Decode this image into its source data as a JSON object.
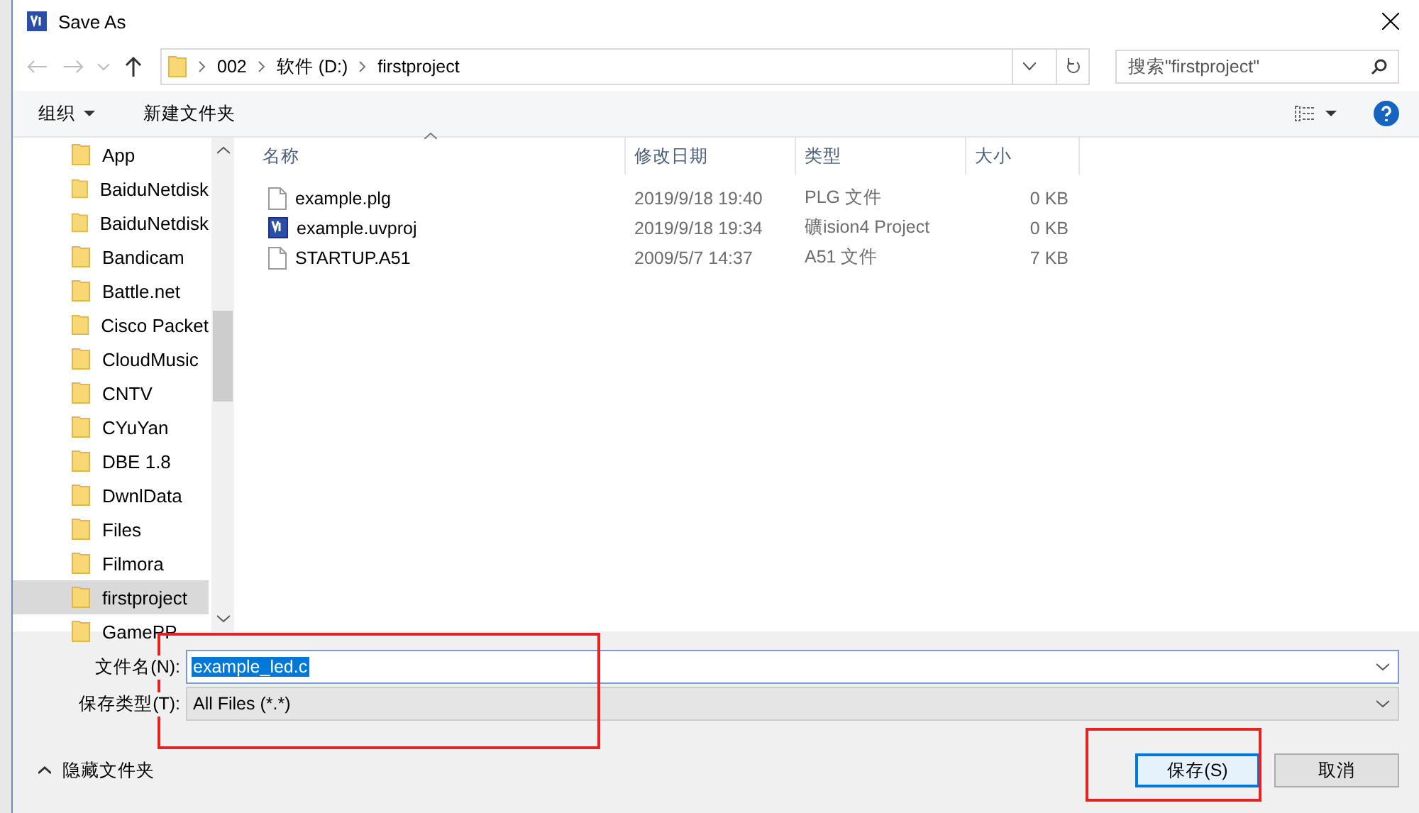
{
  "window": {
    "title": "Save As"
  },
  "address": {
    "crumbs": [
      "002",
      "软件 (D:)",
      "firstproject"
    ]
  },
  "search": {
    "placeholder": "搜索\"firstproject\""
  },
  "toolbar": {
    "organize": "组织",
    "new_folder": "新建文件夹"
  },
  "sidebar": {
    "items": [
      {
        "label": "App",
        "selected": false
      },
      {
        "label": "BaiduNetdisk",
        "selected": false
      },
      {
        "label": "BaiduNetdisk",
        "selected": false
      },
      {
        "label": "Bandicam",
        "selected": false
      },
      {
        "label": "Battle.net",
        "selected": false
      },
      {
        "label": "Cisco Packet",
        "selected": false
      },
      {
        "label": "CloudMusic",
        "selected": false
      },
      {
        "label": "CNTV",
        "selected": false
      },
      {
        "label": "CYuYan",
        "selected": false
      },
      {
        "label": "DBE 1.8",
        "selected": false
      },
      {
        "label": "DwnlData",
        "selected": false
      },
      {
        "label": "Files",
        "selected": false
      },
      {
        "label": "Filmora",
        "selected": false
      },
      {
        "label": "firstproject",
        "selected": true
      },
      {
        "label": "GamePP",
        "selected": false
      }
    ]
  },
  "table": {
    "columns": [
      {
        "label": "名称",
        "sorted": true
      },
      {
        "label": "修改日期",
        "sorted": false
      },
      {
        "label": "类型",
        "sorted": false
      },
      {
        "label": "大小",
        "sorted": false
      }
    ],
    "rows": [
      {
        "kind": "file",
        "name": "example.plg",
        "date": "2019/9/18 19:40",
        "type": "PLG 文件",
        "size": "0 KB"
      },
      {
        "kind": "project",
        "name": "example.uvproj",
        "date": "2019/9/18 19:34",
        "type": "礦ision4 Project",
        "size": "0 KB"
      },
      {
        "kind": "file",
        "name": "STARTUP.A51",
        "date": "2009/5/7 14:37",
        "type": "A51 文件",
        "size": "7 KB"
      }
    ]
  },
  "form": {
    "filename": {
      "label": "文件名(N):",
      "value": "example_led.c"
    },
    "filetype": {
      "label": "保存类型(T):",
      "value": "All Files (*.*)"
    }
  },
  "hide_folders": "隐藏文件夹",
  "buttons": [
    {
      "label": "保存(S)",
      "kind": "primary"
    },
    {
      "label": "取消",
      "kind": "default"
    }
  ]
}
